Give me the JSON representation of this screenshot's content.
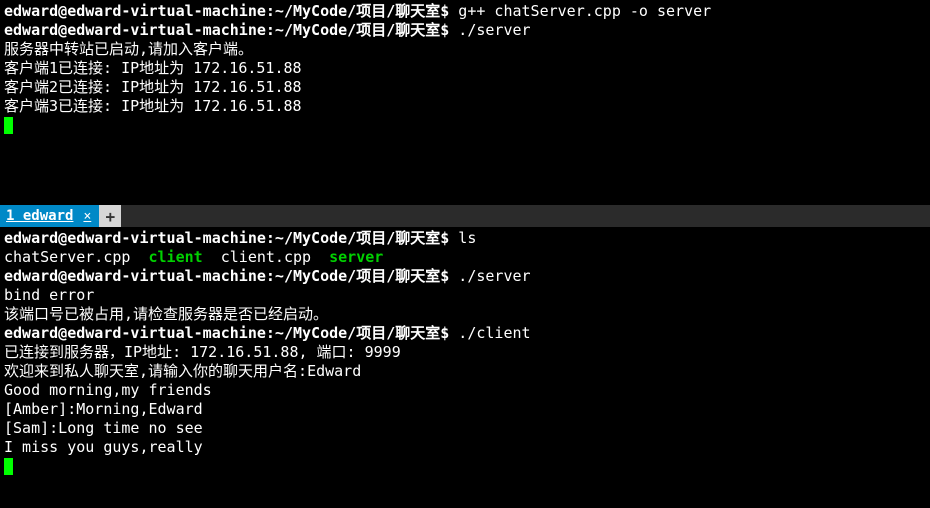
{
  "top": {
    "line1": {
      "prompt": "edward@edward-virtual-machine:~/MyCode/项目/聊天室$",
      "cmd": " g++ chatServer.cpp -o server"
    },
    "line2": {
      "prompt": "edward@edward-virtual-machine:~/MyCode/项目/聊天室$",
      "cmd": " ./server"
    },
    "line3": "服务器中转站已启动,请加入客户端。",
    "line4": "客户端1已连接: IP地址为 172.16.51.88",
    "line5": "客户端2已连接: IP地址为 172.16.51.88",
    "line6": "客户端3已连接: IP地址为 172.16.51.88"
  },
  "tab": {
    "label": "1 edward",
    "close": "×",
    "add": "+"
  },
  "bottom": {
    "line1": {
      "prompt": "edward@edward-virtual-machine:~/MyCode/项目/聊天室$",
      "cmd": " ls"
    },
    "line2a": "chatServer.cpp  ",
    "line2b": "client",
    "line2c": "  client.cpp  ",
    "line2d": "server",
    "line3": {
      "prompt": "edward@edward-virtual-machine:~/MyCode/项目/聊天室$",
      "cmd": " ./server"
    },
    "line4": "bind error",
    "line5": "该端口号已被占用,请检查服务器是否已经启动。",
    "line6": {
      "prompt": "edward@edward-virtual-machine:~/MyCode/项目/聊天室$",
      "cmd": " ./client"
    },
    "line7": "已连接到服务器，IP地址: 172.16.51.88, 端口: 9999",
    "line8": "欢迎来到私人聊天室,请输入你的聊天用户名:Edward",
    "line9": "Good morning,my friends",
    "line10": "[Amber]:Morning,Edward",
    "line11": "[Sam]:Long time no see",
    "line12": "I miss you guys,really"
  }
}
